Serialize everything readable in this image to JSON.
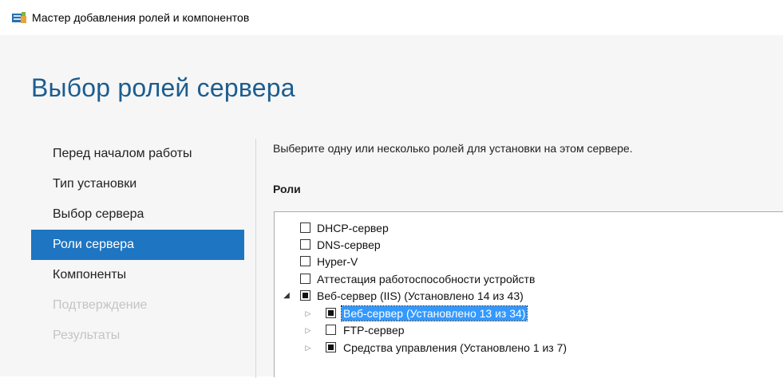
{
  "window": {
    "title": "Мастер добавления ролей и компонентов",
    "icon": "server-wizard-icon"
  },
  "page": {
    "heading": "Выбор ролей сервера"
  },
  "nav": {
    "items": [
      {
        "label": "Перед началом работы",
        "state": "normal"
      },
      {
        "label": "Тип установки",
        "state": "normal"
      },
      {
        "label": "Выбор сервера",
        "state": "normal"
      },
      {
        "label": "Роли сервера",
        "state": "active"
      },
      {
        "label": "Компоненты",
        "state": "normal"
      },
      {
        "label": "Подтверждение",
        "state": "disabled"
      },
      {
        "label": "Результаты",
        "state": "disabled"
      }
    ]
  },
  "main": {
    "instruction": "Выберите одну или несколько ролей для установки на этом сервере.",
    "roles_label": "Роли",
    "roles": [
      {
        "label": "DHCP-сервер",
        "checked": "none"
      },
      {
        "label": "DNS-сервер",
        "checked": "none"
      },
      {
        "label": "Hyper-V",
        "checked": "none"
      },
      {
        "label": "Аттестация работоспособности устройств",
        "checked": "none"
      },
      {
        "label": "Веб-сервер (IIS) (Установлено 14 из 43)",
        "checked": "partial",
        "expander": "expanded"
      },
      {
        "label": "Веб-сервер (Установлено 13 из 34)",
        "checked": "partial",
        "expander": "collapsed",
        "selected": true
      },
      {
        "label": "FTP-сервер",
        "checked": "none",
        "expander": "collapsed"
      },
      {
        "label": "Средства управления (Установлено 1 из 7)",
        "checked": "partial",
        "expander": "collapsed"
      }
    ]
  },
  "colors": {
    "accent": "#1e75c2",
    "heading": "#1c5d8f",
    "selection": "#3399ff",
    "disabled_text": "#c4c4c4"
  }
}
